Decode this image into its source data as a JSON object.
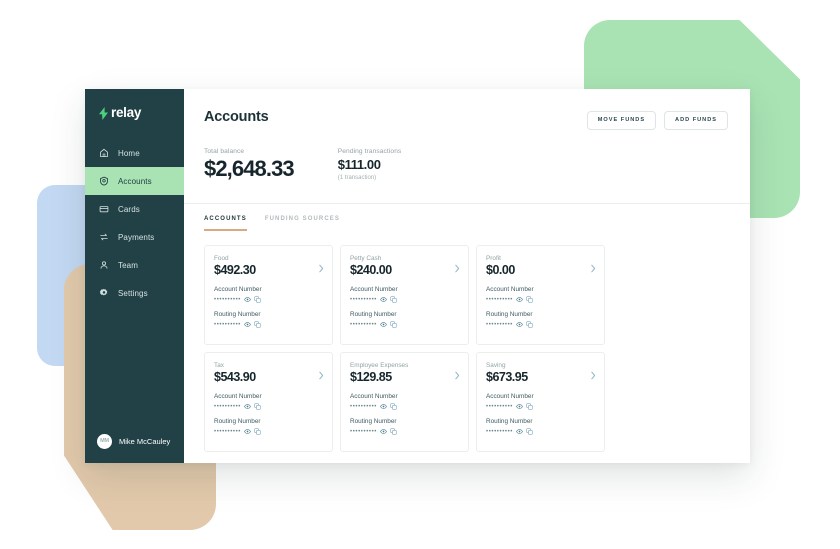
{
  "brand": {
    "name": "relay",
    "logo_icon": "lightning-bolt-icon",
    "accent_green": "#a9e3b3",
    "sidebar_bg": "#224147",
    "tab_underline": "#dba97f"
  },
  "sidebar": {
    "items": [
      {
        "label": "Home",
        "icon": "home-icon",
        "active": false
      },
      {
        "label": "Accounts",
        "icon": "bank-icon",
        "active": true
      },
      {
        "label": "Cards",
        "icon": "card-icon",
        "active": false
      },
      {
        "label": "Payments",
        "icon": "transfer-icon",
        "active": false
      },
      {
        "label": "Team",
        "icon": "person-icon",
        "active": false
      },
      {
        "label": "Settings",
        "icon": "gear-icon",
        "active": false
      }
    ],
    "user": {
      "name": "Mike McCauley",
      "initials": "MM"
    }
  },
  "header": {
    "title": "Accounts",
    "move_funds_label": "MOVE FUNDS",
    "add_funds_label": "ADD FUNDS"
  },
  "summary": {
    "total_label": "Total balance",
    "total_value": "$2,648.33",
    "pending_label": "Pending transactions",
    "pending_value": "$111.00",
    "pending_sub": "(1 transaction)"
  },
  "tabs": [
    {
      "label": "ACCOUNTS",
      "active": true
    },
    {
      "label": "FUNDING SOURCES",
      "active": false
    }
  ],
  "card_fields": {
    "account_number_label": "Account Number",
    "routing_number_label": "Routing Number",
    "masked_value": "••••••••••",
    "eye_icon": "eye-icon",
    "copy_icon": "copy-icon",
    "chevron_icon": "chevron-right-icon"
  },
  "accounts": [
    {
      "name": "Food",
      "balance": "$492.30"
    },
    {
      "name": "Petty Cash",
      "balance": "$240.00"
    },
    {
      "name": "Profit",
      "balance": "$0.00"
    },
    {
      "name": "Tax",
      "balance": "$543.90"
    },
    {
      "name": "Employee Expenses",
      "balance": "$129.85"
    },
    {
      "name": "Saving",
      "balance": "$673.95"
    }
  ]
}
